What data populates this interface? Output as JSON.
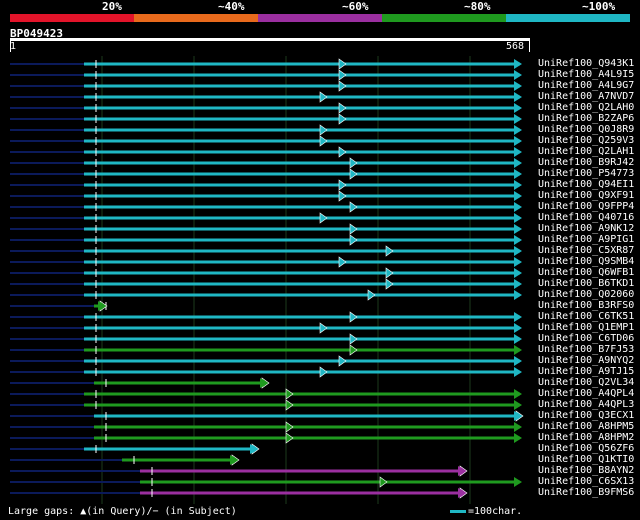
{
  "legend": {
    "segments": [
      {
        "label": "20%",
        "color": "#e3142a"
      },
      {
        "label": "~40%",
        "color": "#e86a1c"
      },
      {
        "label": "~60%",
        "color": "#9b2fa0"
      },
      {
        "label": "~80%",
        "color": "#1f9a1f"
      },
      {
        "label": "~100%",
        "color": "#1fb7c4"
      }
    ]
  },
  "query": {
    "id": "BP049423",
    "start": "1",
    "end": "568"
  },
  "colors": {
    "cyan": "#1fb7c4",
    "green": "#1f9a1f",
    "purple": "#9b2fa0",
    "navy": "#0b1a5a",
    "grid": "#1b3a1b"
  },
  "hits": [
    {
      "label": "UniRef100_Q943K1",
      "color": "cyan"
    },
    {
      "label": "UniRef100_A4L9I5",
      "color": "cyan"
    },
    {
      "label": "UniRef100_A4L9G7",
      "color": "cyan"
    },
    {
      "label": "UniRef100_A7NVD7",
      "color": "cyan"
    },
    {
      "label": "UniRef100_Q2LAH0",
      "color": "cyan"
    },
    {
      "label": "UniRef100_B2ZAP6",
      "color": "cyan"
    },
    {
      "label": "UniRef100_Q0J8R9",
      "color": "cyan"
    },
    {
      "label": "UniRef100_Q259V3",
      "color": "cyan"
    },
    {
      "label": "UniRef100_Q2LAH1",
      "color": "cyan"
    },
    {
      "label": "UniRef100_B9RJ42",
      "color": "cyan"
    },
    {
      "label": "UniRef100_P54773",
      "color": "cyan"
    },
    {
      "label": "UniRef100_Q94EI1",
      "color": "cyan"
    },
    {
      "label": "UniRef100_Q9XF91",
      "color": "cyan"
    },
    {
      "label": "UniRef100_Q9FPP4",
      "color": "cyan"
    },
    {
      "label": "UniRef100_Q40716",
      "color": "cyan"
    },
    {
      "label": "UniRef100_A9NK12",
      "color": "cyan"
    },
    {
      "label": "UniRef100_A9PIG1",
      "color": "cyan"
    },
    {
      "label": "UniRef100_C5XR87",
      "color": "cyan"
    },
    {
      "label": "UniRef100_Q9SMB4",
      "color": "cyan"
    },
    {
      "label": "UniRef100_Q6WFB1",
      "color": "cyan"
    },
    {
      "label": "UniRef100_B6TKD1",
      "color": "cyan"
    },
    {
      "label": "UniRef100_Q02060",
      "color": "cyan"
    },
    {
      "label": "UniRef100_B3RFS0",
      "color": "green"
    },
    {
      "label": "UniRef100_C6TK51",
      "color": "cyan"
    },
    {
      "label": "UniRef100_Q1EMP1",
      "color": "cyan"
    },
    {
      "label": "UniRef100_C6TD06",
      "color": "cyan"
    },
    {
      "label": "UniRef100_B7FJ53",
      "color": "green"
    },
    {
      "label": "UniRef100_A9NYQ2",
      "color": "cyan"
    },
    {
      "label": "UniRef100_A9TJ15",
      "color": "cyan"
    },
    {
      "label": "UniRef100_Q2VL34",
      "color": "green"
    },
    {
      "label": "UniRef100_A4QPL4",
      "color": "green"
    },
    {
      "label": "UniRef100_A4QPL3",
      "color": "green"
    },
    {
      "label": "UniRef100_Q3ECX1",
      "color": "cyan"
    },
    {
      "label": "UniRef100_A8HPM5",
      "color": "green"
    },
    {
      "label": "UniRef100_A8HPM2",
      "color": "green"
    },
    {
      "label": "UniRef100_Q56ZF6",
      "color": "cyan"
    },
    {
      "label": "UniRef100_Q1KTI0",
      "color": "green"
    },
    {
      "label": "UniRef100_B8AYN2",
      "color": "purple"
    },
    {
      "label": "UniRef100_C6SX13",
      "color": "green"
    },
    {
      "label": "UniRef100_B9FMS6",
      "color": "purple"
    }
  ],
  "footer": {
    "gaps_text": "Large gaps: ▲(in Query)/− (in Subject)",
    "scale_text": "=100char."
  }
}
